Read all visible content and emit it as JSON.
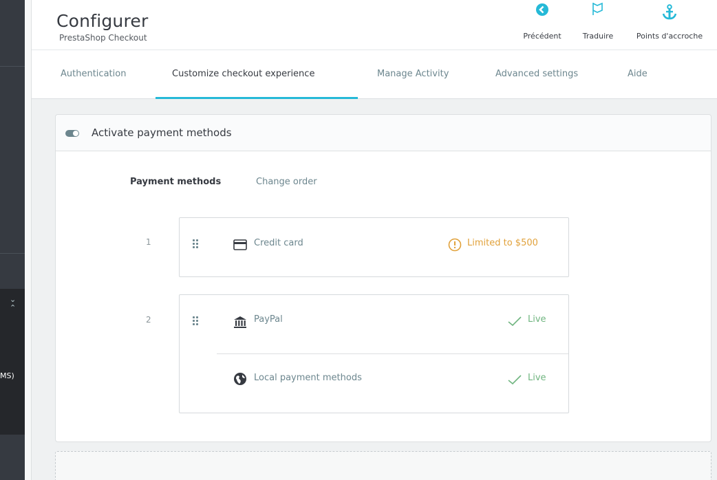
{
  "sidebar": {
    "truncated_item_text": "MS)",
    "chevron_down": "⌄",
    "chevron_up": "⌃"
  },
  "header": {
    "title": "Configurer",
    "subtitle": "PrestaShop Checkout",
    "toolbar": [
      {
        "label": "Précédent",
        "icon": "back-circle-icon"
      },
      {
        "label": "Traduire",
        "icon": "flag-icon"
      },
      {
        "label": "Points d'accroche",
        "icon": "anchor-icon"
      }
    ]
  },
  "tabs": [
    {
      "label": "Authentication",
      "active": false
    },
    {
      "label": "Customize checkout experience",
      "active": true
    },
    {
      "label": "Manage Activity",
      "active": false
    },
    {
      "label": "Advanced settings",
      "active": false
    },
    {
      "label": "Aide",
      "active": false
    }
  ],
  "panel": {
    "title": "Activate payment methods",
    "subtabs": [
      {
        "label": "Payment methods",
        "active": true
      },
      {
        "label": "Change order",
        "active": false
      }
    ],
    "groups": [
      {
        "position": "1",
        "methods": [
          {
            "label": "Credit card",
            "icon": "credit-card-icon",
            "status": "Limited to $500",
            "status_type": "warning",
            "status_icon": "warning-circle-icon"
          }
        ]
      },
      {
        "position": "2",
        "methods": [
          {
            "label": "PayPal",
            "icon": "bank-icon",
            "status": "Live",
            "status_type": "live",
            "status_icon": "check-icon"
          },
          {
            "label": "Local payment methods",
            "icon": "globe-icon",
            "status": "Live",
            "status_type": "live",
            "status_icon": "check-icon"
          }
        ]
      }
    ]
  },
  "colors": {
    "accent": "#25b9d7",
    "warning": "#e1a13a",
    "success": "#70b580",
    "sidebar": "#363a41"
  }
}
